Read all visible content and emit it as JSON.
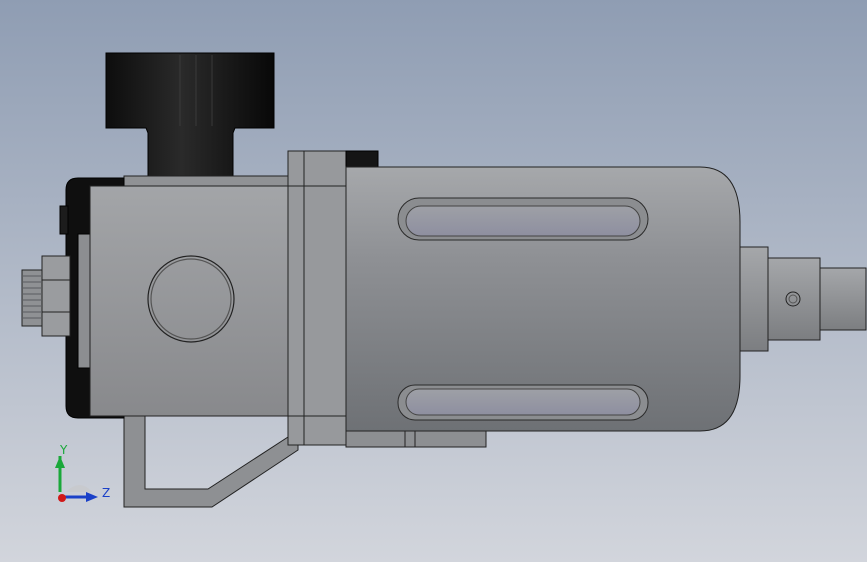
{
  "viewport": {
    "background_top": "#8f9db3",
    "background_bottom": "#d2d5dc"
  },
  "model": {
    "components": [
      "adjustment-knob",
      "regulator-body",
      "pressure-gauge-port",
      "inlet-fitting",
      "bowl-guard",
      "sight-window-top",
      "sight-window-bottom",
      "drain-valve",
      "mounting-bracket"
    ]
  },
  "triad": {
    "y_label": "Y",
    "z_label": "Z",
    "y_color": "#1aa83a",
    "z_color": "#1a40c8",
    "x_color": "#d01818"
  }
}
